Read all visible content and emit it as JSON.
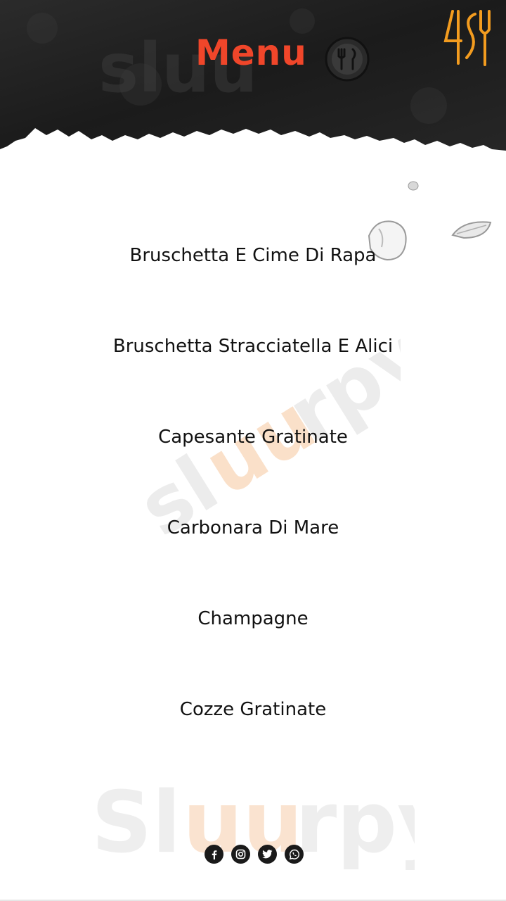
{
  "header": {
    "title": "Menu"
  },
  "menu_items": [
    {
      "label": "Bruschetta E Cime Di Rapa"
    },
    {
      "label": "Bruschetta Stracciatella E Alici"
    },
    {
      "label": "Capesante Gratinate"
    },
    {
      "label": "Carbonara Di Mare"
    },
    {
      "label": "Champagne"
    },
    {
      "label": "Cozze Gratinate"
    }
  ],
  "watermark": {
    "text": "Sluurpy"
  },
  "social": [
    "facebook-icon",
    "instagram-icon",
    "twitter-icon",
    "whatsapp-icon"
  ],
  "colors": {
    "accent": "#f0462a",
    "logo_orange": "#f39c1f",
    "header_dark": "#1f1f1f"
  }
}
